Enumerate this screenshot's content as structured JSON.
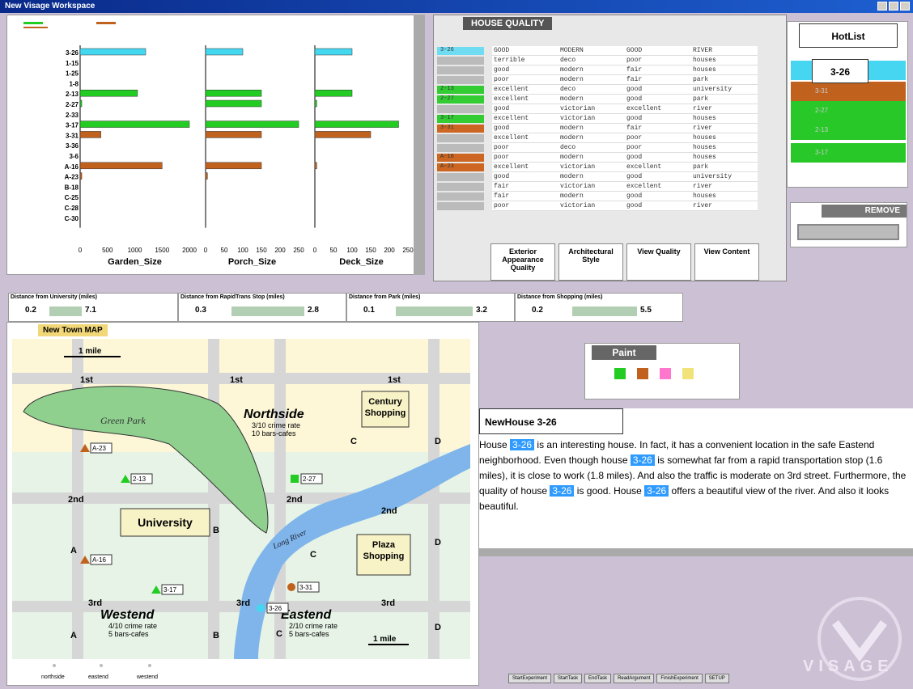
{
  "window": {
    "title": "New Visage Workspace"
  },
  "bar_chart": {
    "rows": [
      "3-26",
      "1-15",
      "1-25",
      "1-8",
      "2-13",
      "2-27",
      "2-33",
      "3-17",
      "3-31",
      "3-36",
      "3-6",
      "A-16",
      "A-23",
      "B-18",
      "C-25",
      "C-28",
      "C-30"
    ],
    "panels": [
      {
        "label": "Garden_Size",
        "ticks": [
          "0",
          "500",
          "1000",
          "1500",
          "2000"
        ],
        "max": 2000,
        "values": [
          1200,
          0,
          0,
          0,
          1050,
          30,
          0,
          2000,
          380,
          0,
          0,
          1500,
          30,
          0,
          0,
          0,
          0
        ],
        "colors": [
          "cyan",
          "",
          "",
          "",
          "green",
          "green",
          "",
          "green",
          "orange",
          "",
          "",
          "orange",
          "orange",
          "",
          "",
          "",
          ""
        ]
      },
      {
        "label": "Porch_Size",
        "ticks": [
          "0",
          "50",
          "100",
          "150",
          "200",
          "250"
        ],
        "max": 250,
        "values": [
          100,
          0,
          0,
          0,
          150,
          150,
          0,
          250,
          150,
          0,
          0,
          150,
          5,
          0,
          0,
          0,
          0
        ],
        "colors": [
          "cyan",
          "",
          "",
          "",
          "green",
          "green",
          "",
          "green",
          "orange",
          "",
          "",
          "orange",
          "orange",
          "",
          "",
          "",
          ""
        ]
      },
      {
        "label": "Deck_Size",
        "ticks": [
          "0",
          "50",
          "100",
          "150",
          "200",
          "250"
        ],
        "max": 250,
        "values": [
          100,
          0,
          0,
          0,
          100,
          5,
          0,
          225,
          150,
          0,
          0,
          5,
          0,
          0,
          0,
          0,
          0
        ],
        "colors": [
          "cyan",
          "",
          "",
          "",
          "green",
          "green",
          "",
          "green",
          "orange",
          "",
          "",
          "orange",
          "",
          "",
          "",
          "",
          ""
        ]
      }
    ]
  },
  "house_quality": {
    "title": "HOUSE QUALITY",
    "columns": [
      "Exterior Appearance Quality",
      "Architectural Style",
      "View Quality",
      "View Content"
    ],
    "rows": [
      {
        "id": "3-26",
        "cells": [
          "GOOD",
          "MODERN",
          "GOOD",
          "RIVER"
        ],
        "color": "#6fdcf2"
      },
      {
        "id": "",
        "cells": [
          "terrible",
          "deco",
          "poor",
          "houses"
        ],
        "color": "#bbbbbb"
      },
      {
        "id": "",
        "cells": [
          "good",
          "modern",
          "fair",
          "houses"
        ],
        "color": "#bbbbbb"
      },
      {
        "id": "",
        "cells": [
          "poor",
          "modern",
          "fair",
          "park"
        ],
        "color": "#bbbbbb"
      },
      {
        "id": "2-13",
        "cells": [
          "excellent",
          "deco",
          "good",
          "university"
        ],
        "color": "#33cc33"
      },
      {
        "id": "2-27",
        "cells": [
          "excellent",
          "modern",
          "good",
          "park"
        ],
        "color": "#33cc33"
      },
      {
        "id": "",
        "cells": [
          "good",
          "victorian",
          "excellent",
          "river"
        ],
        "color": "#bbbbbb"
      },
      {
        "id": "3-17",
        "cells": [
          "excellent",
          "victorian",
          "good",
          "houses"
        ],
        "color": "#33cc33"
      },
      {
        "id": "3-31",
        "cells": [
          "good",
          "modern",
          "fair",
          "river"
        ],
        "color": "#cc6622"
      },
      {
        "id": "",
        "cells": [
          "excellent",
          "modern",
          "poor",
          "houses"
        ],
        "color": "#bbbbbb"
      },
      {
        "id": "",
        "cells": [
          "poor",
          "deco",
          "poor",
          "houses"
        ],
        "color": "#bbbbbb"
      },
      {
        "id": "A-16",
        "cells": [
          "poor",
          "modern",
          "good",
          "houses"
        ],
        "color": "#cc6622"
      },
      {
        "id": "A-23",
        "cells": [
          "excellent",
          "victorian",
          "excellent",
          "park"
        ],
        "color": "#cc6622"
      },
      {
        "id": "",
        "cells": [
          "good",
          "modern",
          "good",
          "university"
        ],
        "color": "#bbbbbb"
      },
      {
        "id": "",
        "cells": [
          "fair",
          "victorian",
          "excellent",
          "river"
        ],
        "color": "#bbbbbb"
      },
      {
        "id": "",
        "cells": [
          "fair",
          "modern",
          "good",
          "houses"
        ],
        "color": "#bbbbbb"
      },
      {
        "id": "",
        "cells": [
          "poor",
          "victorian",
          "good",
          "river"
        ],
        "color": "#bbbbbb"
      }
    ]
  },
  "hotlist": {
    "title": "HotList",
    "selected": "3-26",
    "items": [
      {
        "label": "3-26",
        "color": "#47d6f2"
      },
      {
        "label": "3-31",
        "color": "#c0621e"
      },
      {
        "label": "2-27",
        "color": "#28c828"
      },
      {
        "label": "2-13",
        "color": "#28c828"
      },
      {
        "label": "3-17",
        "color": "#28c828"
      }
    ],
    "remove_label": "REMOVE"
  },
  "distance_filters": [
    {
      "label": "Distance from University (miles)",
      "min": "0.2",
      "max": "7.1"
    },
    {
      "label": "Distance from RapidTrans Stop (miles)",
      "min": "0.3",
      "max": "2.8"
    },
    {
      "label": "Distance from Park (miles)",
      "min": "0.1",
      "max": "3.2"
    },
    {
      "label": "Distance from Shopping (miles)",
      "min": "0.2",
      "max": "5.5"
    }
  ],
  "map": {
    "title": "New Town MAP",
    "scale_label": "1 mile",
    "streets": [
      "1st",
      "2nd",
      "3rd"
    ],
    "avenues": [
      "A",
      "B",
      "C",
      "D"
    ],
    "park_label": "Green Park",
    "river_label": "Long River",
    "regions": [
      {
        "name": "Northside",
        "crime": "3/10",
        "crime_label": "crime rate",
        "bars": "10",
        "bars_label": "bars-cafes"
      },
      {
        "name": "Westend",
        "crime": "4/10",
        "crime_label": "crime rate",
        "bars": "5",
        "bars_label": "bars-cafes"
      },
      {
        "name": "Eastend",
        "crime": "2/10",
        "crime_label": "crime rate",
        "bars": "5",
        "bars_label": "bars-cafes"
      }
    ],
    "landmarks": [
      "University",
      "Century Shopping",
      "Plaza Shopping"
    ],
    "houses": [
      "A-23",
      "2-13",
      "2-27",
      "A-16",
      "3-17",
      "3-26",
      "3-31"
    ],
    "legend": [
      "northside",
      "eastend",
      "westend"
    ]
  },
  "paint": {
    "title": "Paint",
    "colors": [
      "#22cc22",
      "#c0621e",
      "#ff77cc",
      "#f2e27a"
    ]
  },
  "newhouse": {
    "title": "NewHouse 3-26",
    "parts": [
      "House ",
      "3-26",
      " is an interesting house. In fact, it has a convenient location in the safe Eastend neighborhood. Even though house ",
      "3-26",
      " is somewhat far from a rapid transportation stop (1.6 miles), it is close to work (1.8 miles). And also the traffic is moderate on 3rd street. Furthermore, the quality of house ",
      "3-26",
      " is good. House ",
      "3-26",
      " offers a beautiful view of the river. And also it looks beautiful."
    ]
  },
  "bottom_buttons": [
    "StartExperiment",
    "StartTask",
    "EndTask",
    "ReadArgument",
    "FinishExperiment",
    "SETUP"
  ],
  "logo_text": "VISAGE"
}
